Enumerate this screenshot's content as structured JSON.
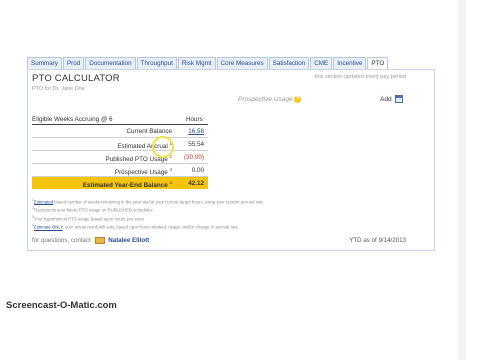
{
  "tabs": [
    {
      "label": "Summary",
      "active": false
    },
    {
      "label": "Prod",
      "active": false
    },
    {
      "label": "Documentation",
      "active": false
    },
    {
      "label": "Throughput",
      "active": false
    },
    {
      "label": "Risk Mgmt",
      "active": false
    },
    {
      "label": "Core Measures",
      "active": false
    },
    {
      "label": "Satisfaction",
      "active": false
    },
    {
      "label": "CME",
      "active": false
    },
    {
      "label": "Incentive",
      "active": false
    },
    {
      "label": "PTO",
      "active": true
    }
  ],
  "header": {
    "title": "PTO CALCULATOR",
    "subtitle": "PTO for Dr. Jane Doe",
    "updated_note": "this section updated every pay period"
  },
  "prospective": {
    "label": "Prospective Usage",
    "help_icon": "question-icon",
    "add_label": "Add",
    "add_icon": "calendar-icon"
  },
  "table": {
    "eligible_label": "Eligible Weeks Accruing @ 6",
    "hours_header": "Hours",
    "rows": [
      {
        "label": "Current Balance",
        "sup": "",
        "value": "16.58",
        "style": "link"
      },
      {
        "label": "Estimated Accrual",
        "sup": "1",
        "value": "55.54",
        "style": "normal"
      },
      {
        "label": "Published PTO Usage",
        "sup": "2",
        "value": "(30.00)",
        "style": "red"
      },
      {
        "label": "Prospective Usage",
        "sup": "3",
        "value": "0.00",
        "style": "normal"
      }
    ],
    "total": {
      "label": "Estimated Year-End Balance",
      "sup": "4",
      "value": "42.12"
    }
  },
  "notes": [
    {
      "num": "1",
      "lead": "Estimated",
      "text": " based number of weeks remaining in the year and at your current target hours, using your current accrual rate"
    },
    {
      "num": "2",
      "lead": "",
      "text": "Represents your future PTO usage on PUBLISHED schedules"
    },
    {
      "num": "3",
      "lead": "",
      "text": "Your hypothetical PTO usage based upon hours you enter"
    },
    {
      "num": "4",
      "lead": "Estimate ONLY",
      "text": ", your actual result will vary, based upon hours worked, usage, and/or change in accrual rate"
    }
  ],
  "footer": {
    "contact_prefix": "for questions, contact",
    "contact_name": "Natalee Elliott",
    "ytd": "YTD as of 9/14/2013"
  },
  "watermark": "Screencast-O-Matic.com"
}
